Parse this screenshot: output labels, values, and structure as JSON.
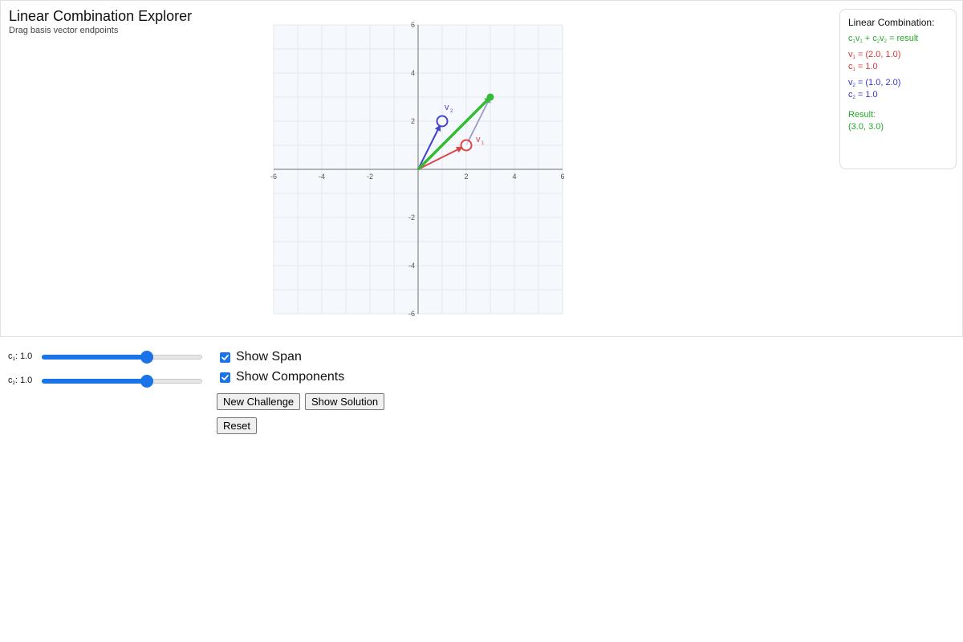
{
  "header": {
    "title": "Linear Combination Explorer",
    "subtitle": "Drag basis vector endpoints"
  },
  "graph": {
    "x_ticks": [
      "-6",
      "-4",
      "-2",
      "2",
      "4",
      "6"
    ],
    "y_ticks": [
      "6",
      "4",
      "2",
      "-2",
      "-4",
      "-6"
    ],
    "range": [
      -6,
      6
    ],
    "grid_step": 1,
    "v1": [
      2.0,
      1.0
    ],
    "v2": [
      1.0,
      2.0
    ],
    "result": [
      3.0,
      3.0
    ],
    "v1_label": "v",
    "v1_label_sub": "1",
    "v2_label": "v",
    "v2_label_sub": "2",
    "colors": {
      "v1": "#dd4444",
      "v2": "#4444cc",
      "result": "#33bb33",
      "component": "#9999cc",
      "grid_bg": "#f5f8fc",
      "grid_line": "#e3e8ef",
      "axis": "#888888"
    }
  },
  "info": {
    "heading": "Linear Combination:",
    "formula": {
      "c": "c",
      "c1": "1",
      "v": "v",
      "v1": "1",
      "plus": " + ",
      "c2": "2",
      "v2": "2",
      "eq": " = result"
    },
    "v1": {
      "name": "v",
      "sub": "1",
      "value": " = (2.0, 1.0)",
      "c_name": "c",
      "c_sub": "1",
      "c_value": " = 1.0"
    },
    "v2": {
      "name": "v",
      "sub": "2",
      "value": " = (1.0, 2.0)",
      "c_name": "c",
      "c_sub": "2",
      "c_value": " = 1.0"
    },
    "result_label": "Result:",
    "result_value": "(3.0, 3.0)"
  },
  "controls": {
    "c1_prefix": "c",
    "c1_sub": "1",
    "c1_suffix": ": 1.0",
    "c2_prefix": "c",
    "c2_sub": "2",
    "c2_suffix": ": 1.0",
    "c1_value": 1.0,
    "c2_value": 1.0,
    "slider_fraction": 0.655,
    "show_span_label": "Show Span",
    "show_span_checked": true,
    "show_components_label": "Show Components",
    "show_components_checked": true,
    "new_challenge": "New Challenge",
    "show_solution": "Show Solution",
    "reset": "Reset"
  }
}
